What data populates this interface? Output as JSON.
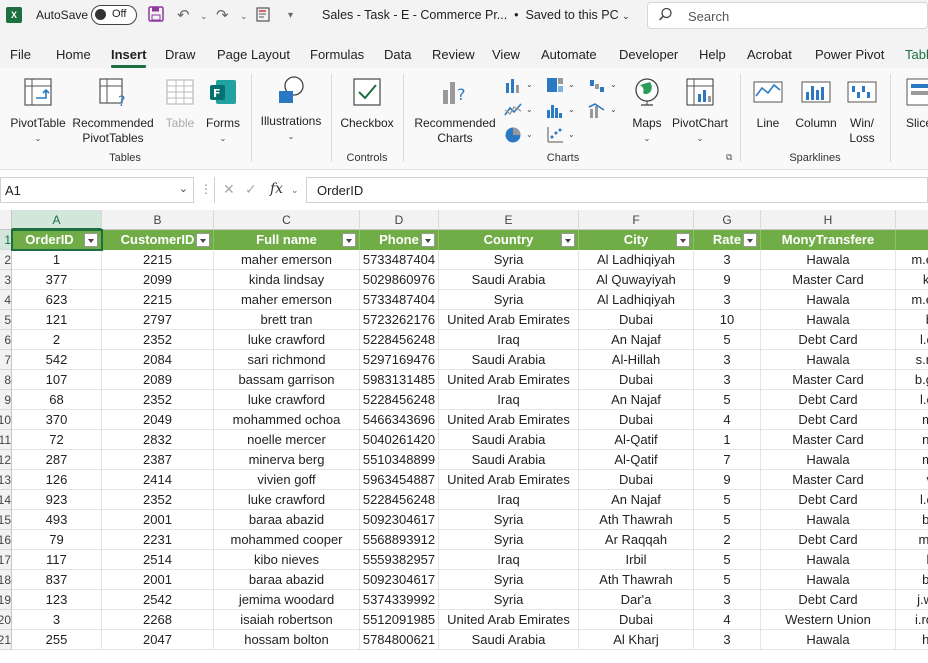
{
  "titlebar": {
    "app_logo": "X",
    "autosave_label": "AutoSave",
    "autosave_state": "Off",
    "doc_title": "Sales - Task - E - Commerce Pr...",
    "save_status": "Saved to this PC",
    "search_placeholder": "Search"
  },
  "ribbon_tabs": [
    "File",
    "Home",
    "Insert",
    "Draw",
    "Page Layout",
    "Formulas",
    "Data",
    "Review",
    "View",
    "Automate",
    "Developer",
    "Help",
    "Acrobat",
    "Power Pivot",
    "Tabl"
  ],
  "ribbon": {
    "tables": {
      "pivottable": "PivotTable",
      "recommended_pivot_1": "Recommended",
      "recommended_pivot_2": "PivotTables",
      "table": "Table",
      "forms": "Forms",
      "group": "Tables"
    },
    "illustrations": "Illustrations",
    "controls": {
      "checkbox": "Checkbox",
      "group": "Controls"
    },
    "charts": {
      "recommended_1": "Recommended",
      "recommended_2": "Charts",
      "maps": "Maps",
      "pivotchart": "PivotChart",
      "group": "Charts"
    },
    "sparklines": {
      "line": "Line",
      "column": "Column",
      "winloss_1": "Win/",
      "winloss_2": "Loss",
      "group": "Sparklines"
    },
    "slicer": "Slice"
  },
  "formula_bar": {
    "name_box": "A1",
    "fx": "fx",
    "content": "OrderID"
  },
  "columns": [
    "A",
    "B",
    "C",
    "D",
    "E",
    "F",
    "G",
    "H"
  ],
  "headers": [
    "OrderID",
    "CustomerID",
    "Full name",
    "Phone",
    "Country",
    "City",
    "Rate",
    "MonyTransfere"
  ],
  "row_numbers": [
    "1",
    "2",
    "3",
    "4",
    "5",
    "6",
    "7",
    "8",
    "9",
    "10",
    "11",
    "12",
    "13",
    "14",
    "15",
    "16",
    "17",
    "18",
    "19",
    "20",
    "21"
  ],
  "rows": [
    [
      "1",
      "2215",
      "maher emerson",
      "5733487404",
      "Syria",
      "Al Ladhiqiyah",
      "3",
      "Hawala",
      "m.e"
    ],
    [
      "377",
      "2099",
      "kinda lindsay",
      "5029860976",
      "Saudi Arabia",
      "Al Quwayiyah",
      "9",
      "Master Card",
      "k."
    ],
    [
      "623",
      "2215",
      "maher emerson",
      "5733487404",
      "Syria",
      "Al Ladhiqiyah",
      "3",
      "Hawala",
      "m.e"
    ],
    [
      "121",
      "2797",
      "brett tran",
      "5723262176",
      "United Arab Emirates",
      "Dubai",
      "10",
      "Hawala",
      "b"
    ],
    [
      "2",
      "2352",
      "luke crawford",
      "5228456248",
      "Iraq",
      "An Najaf",
      "5",
      "Debt Card",
      "l.c"
    ],
    [
      "542",
      "2084",
      "sari richmond",
      "5297169476",
      "Saudi Arabia",
      "Al-Hillah",
      "3",
      "Hawala",
      "s.ri"
    ],
    [
      "107",
      "2089",
      "bassam garrison",
      "5983131485",
      "United Arab Emirates",
      "Dubai",
      "3",
      "Master Card",
      "b.g"
    ],
    [
      "68",
      "2352",
      "luke crawford",
      "5228456248",
      "Iraq",
      "An Najaf",
      "5",
      "Debt Card",
      "l.c"
    ],
    [
      "370",
      "2049",
      "mohammed ochoa",
      "5466343696",
      "United Arab Emirates",
      "Dubai",
      "4",
      "Debt Card",
      "m"
    ],
    [
      "72",
      "2832",
      "noelle mercer",
      "5040261420",
      "Saudi Arabia",
      "Al-Qatif",
      "1",
      "Master Card",
      "n."
    ],
    [
      "287",
      "2387",
      "minerva berg",
      "5510348899",
      "Saudi Arabia",
      "Al-Qatif",
      "7",
      "Hawala",
      "m"
    ],
    [
      "126",
      "2414",
      "vivien goff",
      "5963454887",
      "United Arab Emirates",
      "Dubai",
      "9",
      "Master Card",
      "v"
    ],
    [
      "923",
      "2352",
      "luke crawford",
      "5228456248",
      "Iraq",
      "An Najaf",
      "5",
      "Debt Card",
      "l.c"
    ],
    [
      "493",
      "2001",
      "baraa abazid",
      "5092304617",
      "Syria",
      "Ath Thawrah",
      "5",
      "Hawala",
      "b."
    ],
    [
      "79",
      "2231",
      "mohammed cooper",
      "5568893912",
      "Syria",
      "Ar Raqqah",
      "2",
      "Debt Card",
      "m."
    ],
    [
      "117",
      "2514",
      "kibo nieves",
      "5559382957",
      "Iraq",
      "Irbil",
      "5",
      "Hawala",
      "k"
    ],
    [
      "837",
      "2001",
      "baraa abazid",
      "5092304617",
      "Syria",
      "Ath Thawrah",
      "5",
      "Hawala",
      "b."
    ],
    [
      "123",
      "2542",
      "jemima woodard",
      "5374339992",
      "Syria",
      "Dar'a",
      "3",
      "Debt Card",
      "j.w"
    ],
    [
      "3",
      "2268",
      "isaiah robertson",
      "5512091985",
      "United Arab Emirates",
      "Dubai",
      "4",
      "Western Union",
      "i.ro"
    ],
    [
      "255",
      "2047",
      "hossam bolton",
      "5784800621",
      "Saudi Arabia",
      "Al Kharj",
      "3",
      "Hawala",
      "h."
    ]
  ]
}
